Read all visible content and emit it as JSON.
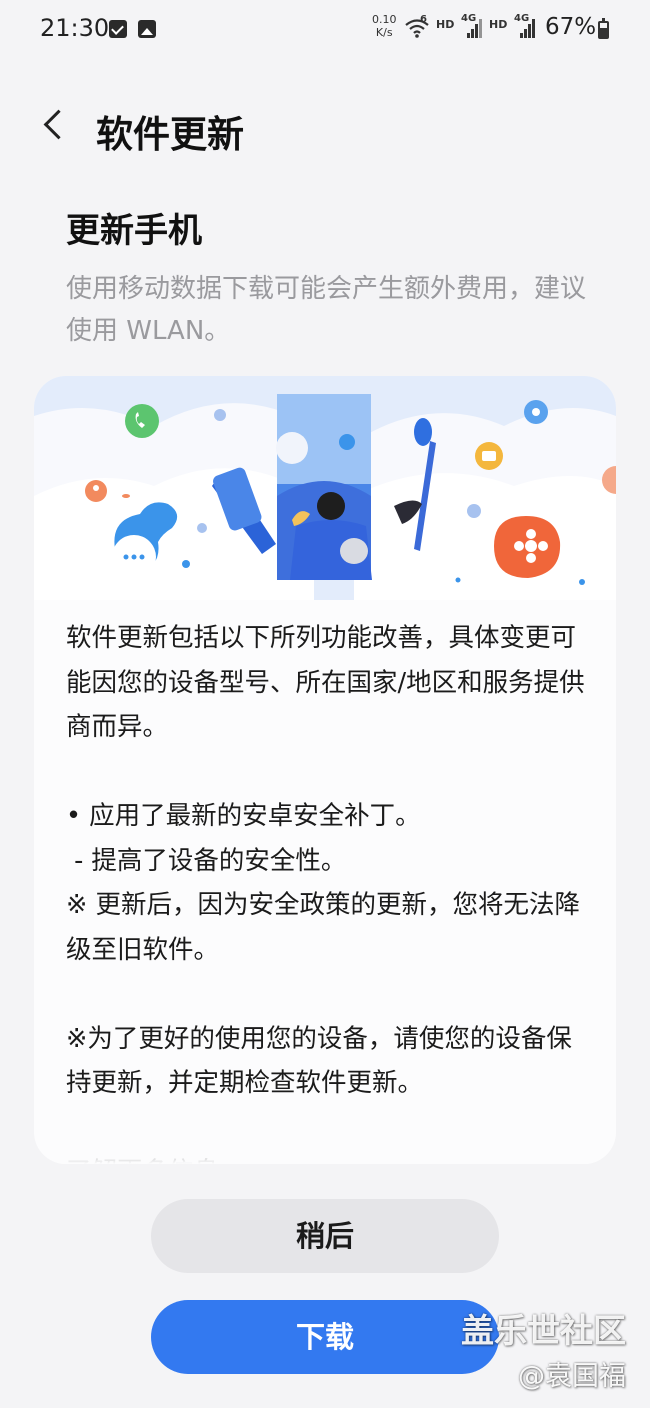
{
  "status_bar": {
    "time": "21:30",
    "net_speed_value": "0.10",
    "net_speed_unit": "K/s",
    "wifi_label": "6",
    "hd1": "HD",
    "sim1_net": "4G",
    "hd2": "HD",
    "sim2_net": "4G",
    "battery_text": "67%",
    "battery_level": 0.67
  },
  "header": {
    "title": "软件更新"
  },
  "update": {
    "subtitle": "更新手机",
    "data_notice": "使用移动数据下载可能会产生额外费用，建议使用 WLAN。",
    "details": "软件更新包括以下所列功能改善，具体变更可能因您的设备型号、所在国家/地区和服务提供商而异。\n\n• 应用了最新的安卓安全补丁。\n - 提高了设备的安全性。\n※ 更新后，因为安全政策的更新，您将无法降级至旧软件。\n\n※为了更好的使用您的设备，请使您的设备保持更新，并定期检查软件更新。\n\n了解更多信息"
  },
  "buttons": {
    "later": "稍后",
    "download": "下载"
  },
  "watermark": {
    "line1": "盖乐世社区",
    "line2": "@袁国福"
  },
  "colors": {
    "background": "#f4f4f6",
    "card": "#fcfcfd",
    "primary_button": "#3379f0",
    "secondary_button": "#e5e5e8",
    "muted_text": "#9a9a9e"
  }
}
